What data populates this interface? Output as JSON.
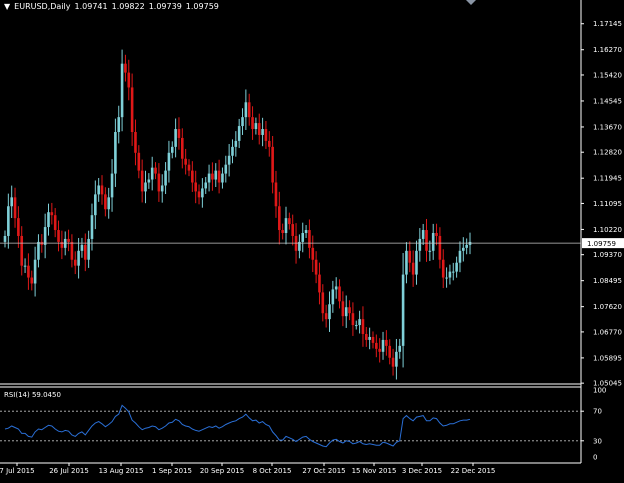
{
  "header": {
    "symbol_timeframe": "EURUSD,Daily",
    "ohlc": [
      "1.09741",
      "1.09822",
      "1.09739",
      "1.09759"
    ]
  },
  "current_price_label": "1.09759",
  "rsi": {
    "label": "RSI(14) 59.0450",
    "levels": [
      "70",
      "30"
    ],
    "ticks": [
      "100",
      "70",
      "30",
      "0"
    ]
  },
  "colors": {
    "bull": "#7fd0d8",
    "bear": "#e01818",
    "grid": "#ffffff",
    "rsi_line": "#2a6fd6",
    "background": "#000000"
  },
  "chart_data": [
    {
      "type": "candlestick",
      "y_ticks": [
        "1.17145",
        "1.16270",
        "1.15420",
        "1.14545",
        "1.13670",
        "1.12820",
        "1.11945",
        "1.11095",
        "1.10220",
        "1.09370",
        "1.08495",
        "1.07620",
        "1.06770",
        "1.05895",
        "1.05045"
      ],
      "ylim": [
        1.0505,
        1.1754
      ],
      "x_ticks": [
        "7 Jul 2015",
        "26 Jul 2015",
        "13 Aug 2015",
        "1 Sep 2015",
        "20 Sep 2015",
        "8 Oct 2015",
        "27 Oct 2015",
        "15 Nov 2015",
        "3 Dec 2015",
        "22 Dec 2015"
      ],
      "closes": [
        1.1,
        1.11,
        1.113,
        1.106,
        1.1,
        1.09,
        1.09,
        1.086,
        1.084,
        1.092,
        1.098,
        1.097,
        1.103,
        1.108,
        1.107,
        1.102,
        1.098,
        1.096,
        1.099,
        1.098,
        1.092,
        1.09,
        1.095,
        1.097,
        1.092,
        1.099,
        1.107,
        1.114,
        1.117,
        1.114,
        1.109,
        1.113,
        1.121,
        1.135,
        1.14,
        1.158,
        1.155,
        1.15,
        1.135,
        1.128,
        1.122,
        1.115,
        1.118,
        1.119,
        1.123,
        1.121,
        1.115,
        1.117,
        1.122,
        1.128,
        1.13,
        1.136,
        1.133,
        1.126,
        1.124,
        1.122,
        1.118,
        1.115,
        1.113,
        1.116,
        1.118,
        1.121,
        1.119,
        1.122,
        1.118,
        1.121,
        1.124,
        1.127,
        1.13,
        1.132,
        1.137,
        1.14,
        1.145,
        1.14,
        1.136,
        1.138,
        1.134,
        1.136,
        1.132,
        1.13,
        1.118,
        1.11,
        1.102,
        1.101,
        1.106,
        1.104,
        1.1,
        1.095,
        1.098,
        1.101,
        1.102,
        1.096,
        1.092,
        1.087,
        1.081,
        1.074,
        1.072,
        1.077,
        1.082,
        1.083,
        1.078,
        1.073,
        1.076,
        1.074,
        1.07,
        1.07,
        1.072,
        1.067,
        1.065,
        1.066,
        1.064,
        1.062,
        1.061,
        1.065,
        1.063,
        1.059,
        1.056,
        1.061,
        1.063,
        1.087,
        1.095,
        1.091,
        1.087,
        1.095,
        1.099,
        1.102,
        1.095,
        1.095,
        1.101,
        1.1,
        1.092,
        1.086,
        1.086,
        1.088,
        1.088,
        1.091,
        1.095,
        1.096,
        1.097,
        1.098
      ],
      "last_price": 1.09759
    },
    {
      "type": "line",
      "name": "RSI(14)",
      "ylim": [
        0,
        100
      ],
      "levels": [
        70,
        30
      ],
      "values": [
        46,
        47,
        50,
        48,
        46,
        40,
        40,
        36,
        35,
        42,
        46,
        45,
        48,
        51,
        50,
        46,
        43,
        42,
        44,
        43,
        38,
        36,
        40,
        42,
        38,
        44,
        50,
        54,
        56,
        53,
        49,
        52,
        56,
        63,
        66,
        78,
        74,
        69,
        58,
        54,
        49,
        45,
        47,
        48,
        50,
        49,
        45,
        47,
        50,
        54,
        55,
        59,
        57,
        52,
        50,
        49,
        46,
        44,
        43,
        45,
        47,
        49,
        48,
        50,
        47,
        49,
        52,
        54,
        56,
        57,
        60,
        62,
        66,
        61,
        57,
        58,
        54,
        56,
        52,
        50,
        42,
        37,
        31,
        31,
        36,
        34,
        32,
        29,
        32,
        35,
        36,
        32,
        29,
        27,
        25,
        23,
        22,
        27,
        31,
        32,
        29,
        27,
        30,
        29,
        26,
        27,
        29,
        26,
        25,
        26,
        25,
        24,
        24,
        28,
        27,
        25,
        23,
        28,
        30,
        60,
        64,
        60,
        57,
        62,
        63,
        64,
        57,
        57,
        61,
        60,
        54,
        50,
        51,
        53,
        53,
        55,
        57,
        58,
        58,
        59
      ]
    }
  ]
}
